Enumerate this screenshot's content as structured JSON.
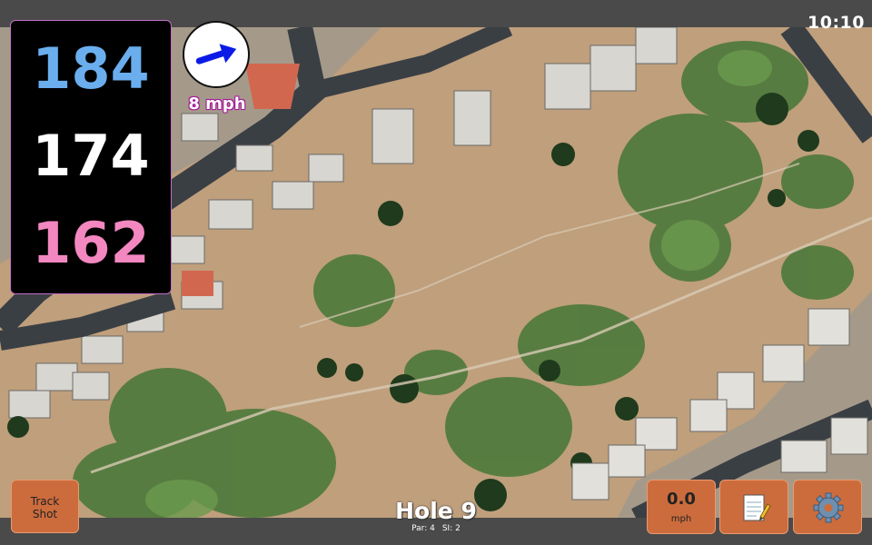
{
  "status_bar": {
    "time": "10:10"
  },
  "distances": {
    "back": "184",
    "middle": "174",
    "front": "162"
  },
  "wind": {
    "speed": "8 mph",
    "direction_icon": "arrow-right-icon"
  },
  "hole": {
    "title": "Hole 9",
    "par": "Par: 4",
    "si": "SI: 2"
  },
  "buttons": {
    "track_shot": "Track\nShot",
    "speed_value": "0.0",
    "speed_unit": "mph",
    "notes_icon": "notepad-icon",
    "settings_icon": "gear-icon"
  },
  "colors": {
    "back_distance": "#6aaeee",
    "middle_distance": "#ffffff",
    "front_distance": "#f387c0",
    "button": "#cc6c3d",
    "wind_arrow": "#0b1be6"
  }
}
